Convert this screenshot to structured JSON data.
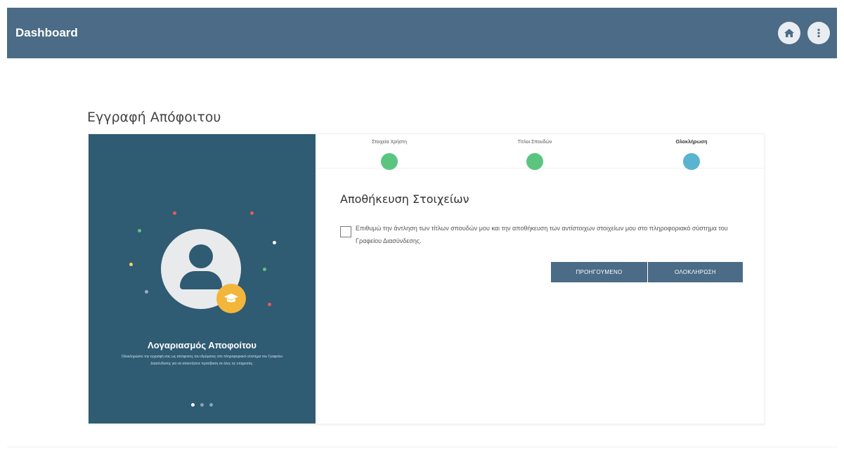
{
  "header": {
    "title": "Dashboard",
    "bg": "#4b6b86"
  },
  "page": {
    "title": "Εγγραφή Απόφοιτου"
  },
  "left_panel": {
    "title": "Λογαριασμός Αποφοίτου",
    "description": "Ολοκληρώστε την εγγραφή σας ως απόφοιτος του ιδρύματος στο πληροφοριακό σύστημα του Γραφείου Διασύνδεσης για να αποκτήσετε πρόσβαση σε όλες τις υπηρεσίες.",
    "bg": "#2f5b73",
    "carousel_active": 0
  },
  "steps": [
    {
      "label": "Στοιχεία Χρήστη",
      "state": "complete",
      "color": "#5bc580"
    },
    {
      "label": "Τίτλοι Σπουδών",
      "state": "complete",
      "color": "#5bc580"
    },
    {
      "label": "Ολοκλήρωση",
      "state": "active",
      "color": "#5ab4cf"
    }
  ],
  "form": {
    "section_title": "Αποθήκευση Στοιχείων",
    "consent_text": "Επιθυμώ την άντληση των τίτλων σπουδών μου και την αποθήκευση των αντίστοιχων στοιχείων μου στο πληροφοριακό σύστημα του Γραφείου Διασύνδεσης.",
    "consent_checked": false,
    "prev_button": "ΠΡΟΗΓΟΥΜΕΝΟ",
    "finish_button": "ΟΛΟΚΛΗΡΩΣΗ"
  }
}
